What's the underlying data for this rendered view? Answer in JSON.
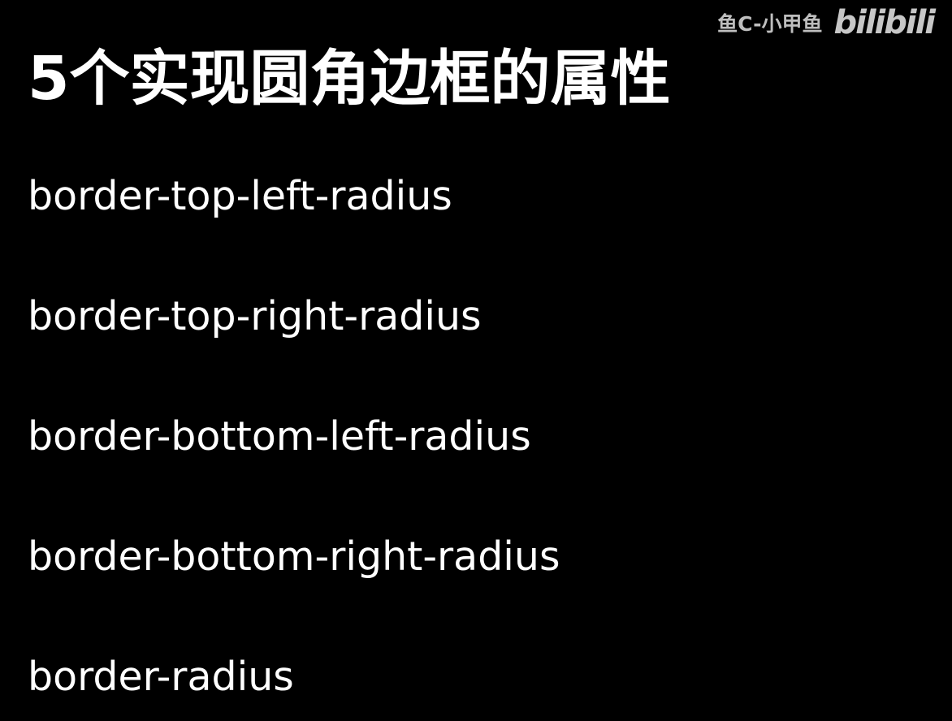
{
  "watermark": {
    "author": "鱼C-小甲鱼",
    "logo": "bilibili"
  },
  "title": "5个实现圆角边框的属性",
  "properties": [
    "border-top-left-radius",
    "border-top-right-radius",
    "border-bottom-left-radius",
    "border-bottom-right-radius",
    "border-radius"
  ],
  "colors": {
    "background": "#000000",
    "text": "#ffffff",
    "watermark": "#cfcfcf"
  }
}
